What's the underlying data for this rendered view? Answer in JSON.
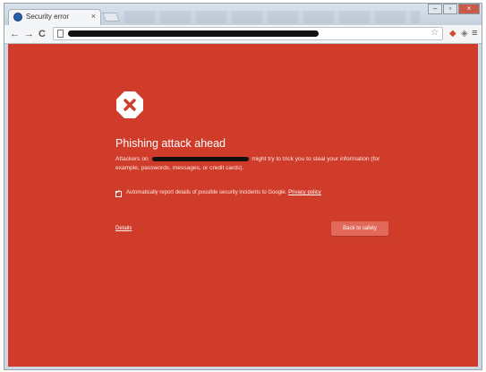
{
  "browser": {
    "tab_title": "Security error",
    "tab_close": "×",
    "nav": {
      "back": "←",
      "forward": "→",
      "reload": "C"
    },
    "star": "☆",
    "menu": "≡"
  },
  "interstitial": {
    "heading": "Phishing attack ahead",
    "body_prefix": "Attackers on",
    "body_suffix": "might try to trick you to steal your information (for example, passwords, messages, or credit cards).",
    "report_text": "Automatically report details of possible security incidents to Google.",
    "privacy_link": "Privacy policy",
    "report_checked": true,
    "details_link": "Details",
    "back_button": "Back to safety"
  },
  "colors": {
    "page_background": "#d03c2a",
    "button_background": "#e0695a"
  }
}
